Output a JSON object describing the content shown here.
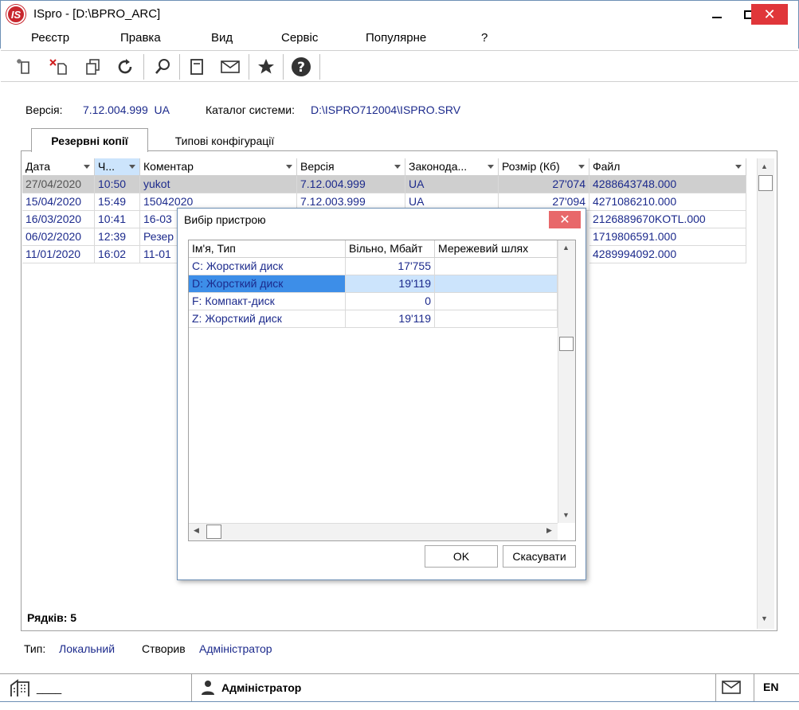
{
  "window": {
    "title": "ISpro - [D:\\BPRO_ARC]",
    "logo": "IS"
  },
  "menu": [
    "Реєстр",
    "Правка",
    "Вид",
    "Сервіс",
    "Популярне",
    "?"
  ],
  "toolbar_icons": [
    "new-doc-icon",
    "delete-doc-icon",
    "copy-doc-icon",
    "refresh-icon",
    "search-icon",
    "document-icon",
    "mail-icon",
    "star-icon",
    "help-icon"
  ],
  "info": {
    "version_label": "Версія:",
    "version_value": "7.12.004.999  UA",
    "catalog_label": "Каталог системи:",
    "catalog_value": "D:\\ISPRO712004\\ISPRO.SRV"
  },
  "tabs": [
    "Резервні копії",
    "Типові конфігурації"
  ],
  "grid": {
    "columns": [
      "Дата",
      "Ч...",
      "Коментар",
      "Версія",
      "Законода...",
      "Розмір (Кб)",
      "Файл"
    ],
    "rows": [
      [
        "27/04/2020",
        "10:50",
        "yukot",
        "7.12.004.999",
        "UA",
        "27'074",
        "4288643748.000"
      ],
      [
        "15/04/2020",
        "15:49",
        "15042020",
        "7.12.003.999",
        "UA",
        "27'094",
        "4271086210.000"
      ],
      [
        "16/03/2020",
        "10:41",
        "16-03",
        "",
        "",
        "",
        "2126889670KOTL.000"
      ],
      [
        "06/02/2020",
        "12:39",
        "Резер",
        "",
        "",
        "",
        "1719806591.000"
      ],
      [
        "11/01/2020",
        "16:02",
        "11-01",
        "",
        "",
        "",
        "4289994092.000"
      ]
    ]
  },
  "rows_count": "Рядків: 5",
  "bottom": {
    "type_label": "Тип:",
    "type_value": "Локальний",
    "created_label": "Створив",
    "created_value": "Адміністратор"
  },
  "status": {
    "left": "____",
    "user": "Адміністратор",
    "lang": "EN"
  },
  "dialog": {
    "title": "Вибір пристрою",
    "columns": [
      "Ім'я, Тип",
      "Вільно, Мбайт",
      "Мережевий шлях"
    ],
    "rows": [
      [
        "C:   Жорсткий диск",
        "17'755",
        ""
      ],
      [
        "D:   Жорсткий диск",
        "19'119",
        ""
      ],
      [
        "F:   Компакт-диск",
        "0",
        ""
      ],
      [
        "Z:   Жорсткий диск",
        "19'119",
        ""
      ]
    ],
    "ok_label": "OK",
    "cancel_label": "Скасувати"
  },
  "colors": {
    "link_text": "#1c2a8c",
    "selection": "#3d8ee8",
    "close_red": "#e0363a"
  }
}
